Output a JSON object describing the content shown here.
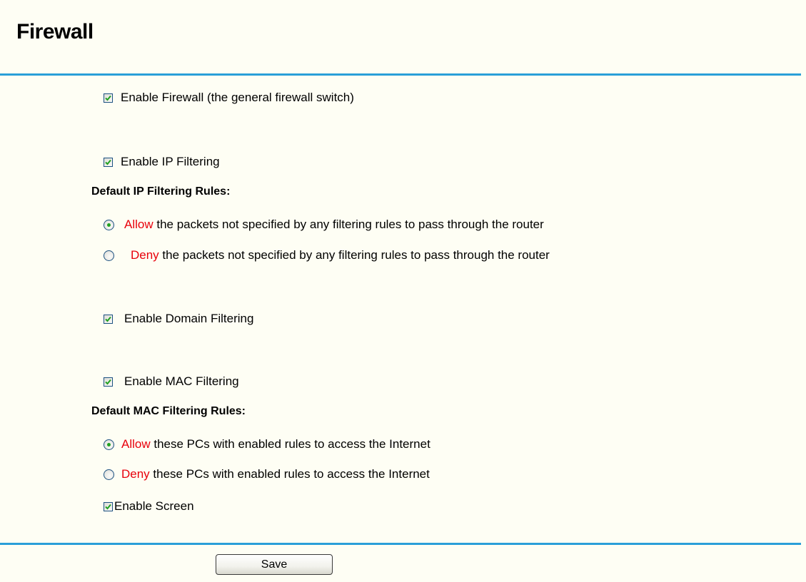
{
  "page_title": "Firewall",
  "options": {
    "enable_firewall": {
      "label": "Enable Firewall (the general firewall switch)",
      "checked": true
    },
    "enable_ip_filtering": {
      "label": "Enable IP Filtering",
      "checked": true
    },
    "ip_rules": {
      "heading": "Default IP Filtering Rules:",
      "allow": {
        "keyword": "Allow",
        "text": "the packets not specified by any filtering rules to pass through the router",
        "selected": true
      },
      "deny": {
        "keyword": "Deny",
        "text": "the packets not specified by any filtering rules to pass through the router",
        "selected": false
      }
    },
    "enable_domain_filtering": {
      "label": "Enable Domain Filtering",
      "checked": true
    },
    "enable_mac_filtering": {
      "label": "Enable MAC Filtering",
      "checked": true
    },
    "mac_rules": {
      "heading": "Default MAC Filtering Rules:",
      "allow": {
        "keyword": "Allow",
        "text": "these PCs with enabled rules to access the Internet",
        "selected": true
      },
      "deny": {
        "keyword": "Deny",
        "text": "these PCs with enabled rules to access the Internet",
        "selected": false
      }
    },
    "enable_screen": {
      "label": "Enable Screen",
      "checked": true
    }
  },
  "save_label": "Save",
  "colors": {
    "rule": "#2a9fd8",
    "keyword": "#e8000c",
    "check": "#21a121",
    "background": "#fefef4"
  }
}
